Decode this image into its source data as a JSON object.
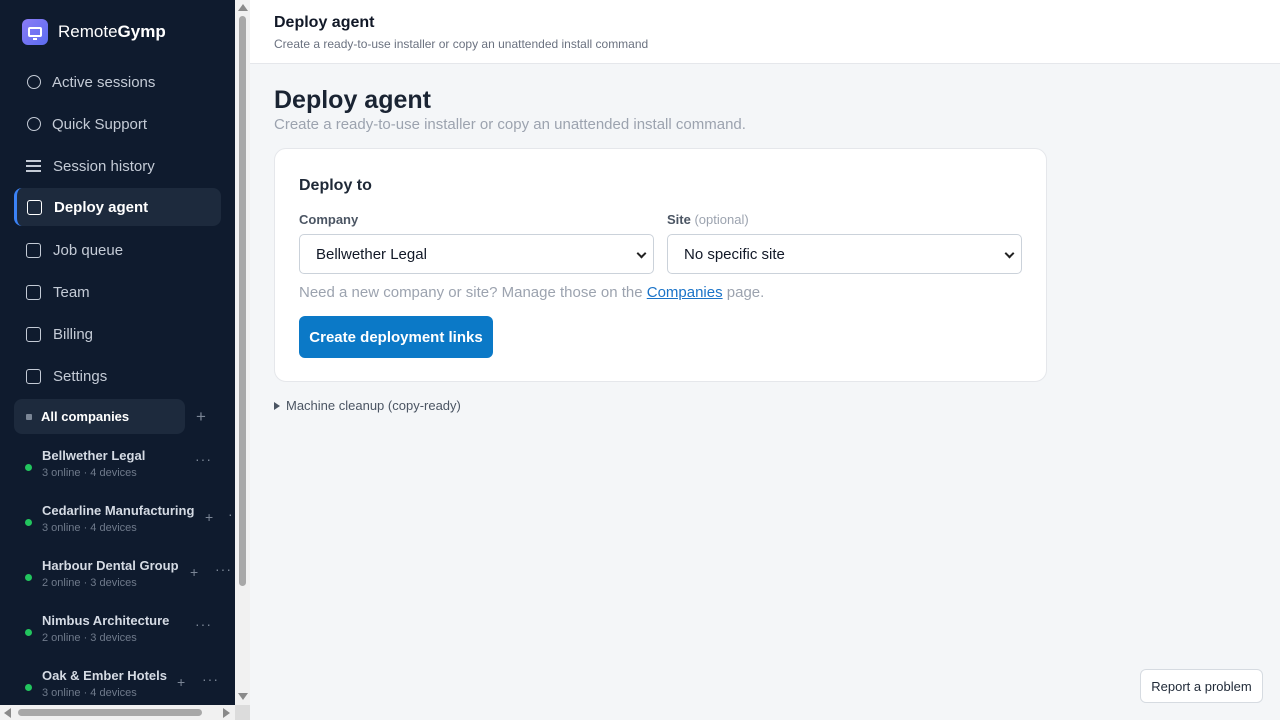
{
  "brand": {
    "name_regular": "Remote",
    "name_bold": "Gymp",
    "icon": "monitor-icon"
  },
  "nav": [
    {
      "label": "Active sessions",
      "icon": "circle-icon",
      "active": false
    },
    {
      "label": "Quick Support",
      "icon": "circle-icon",
      "active": false
    },
    {
      "label": "Session history",
      "icon": "list-icon",
      "active": false
    },
    {
      "label": "Deploy agent",
      "icon": "square-icon",
      "active": true
    },
    {
      "label": "Job queue",
      "icon": "square-icon",
      "active": false
    },
    {
      "label": "Team",
      "icon": "square-icon",
      "active": false
    },
    {
      "label": "Billing",
      "icon": "square-icon",
      "active": false
    },
    {
      "label": "Settings",
      "icon": "square-icon",
      "active": false
    }
  ],
  "companies": {
    "all_label": "All companies",
    "add_symbol": "+",
    "items": [
      {
        "name": "Bellwether Legal",
        "meta": "3 online · 4 devices"
      },
      {
        "name": "Cedarline Manufacturing",
        "meta": "3 online · 4 devices"
      },
      {
        "name": "Harbour Dental Group",
        "meta": "2 online · 3 devices"
      },
      {
        "name": "Nimbus Architecture",
        "meta": "2 online · 3 devices"
      },
      {
        "name": "Oak & Ember Hotels",
        "meta": "3 online · 4 devices"
      }
    ],
    "more_symbol": "···",
    "plus_symbol": "+"
  },
  "header": {
    "title": "Deploy agent",
    "subtitle": "Create a ready-to-use installer or copy an unattended install command"
  },
  "page": {
    "title": "Deploy agent",
    "subtitle": "Create a ready-to-use installer or copy an unattended install command."
  },
  "deploy_card": {
    "title": "Deploy to",
    "company_label": "Company",
    "company_value": "Bellwether Legal",
    "site_label": "Site",
    "site_optional": "(optional)",
    "site_value": "No specific site",
    "help_prefix": "Need a new company or site? Manage those on the",
    "help_link": "Companies",
    "help_suffix": "page.",
    "button_label": "Create deployment links"
  },
  "cleanup_label": "Machine cleanup (copy-ready)",
  "report_label": "Report a problem",
  "colors": {
    "sidebar_bg": "#0f1b2e",
    "primary": "#0b79c7",
    "online": "#22c55e"
  }
}
